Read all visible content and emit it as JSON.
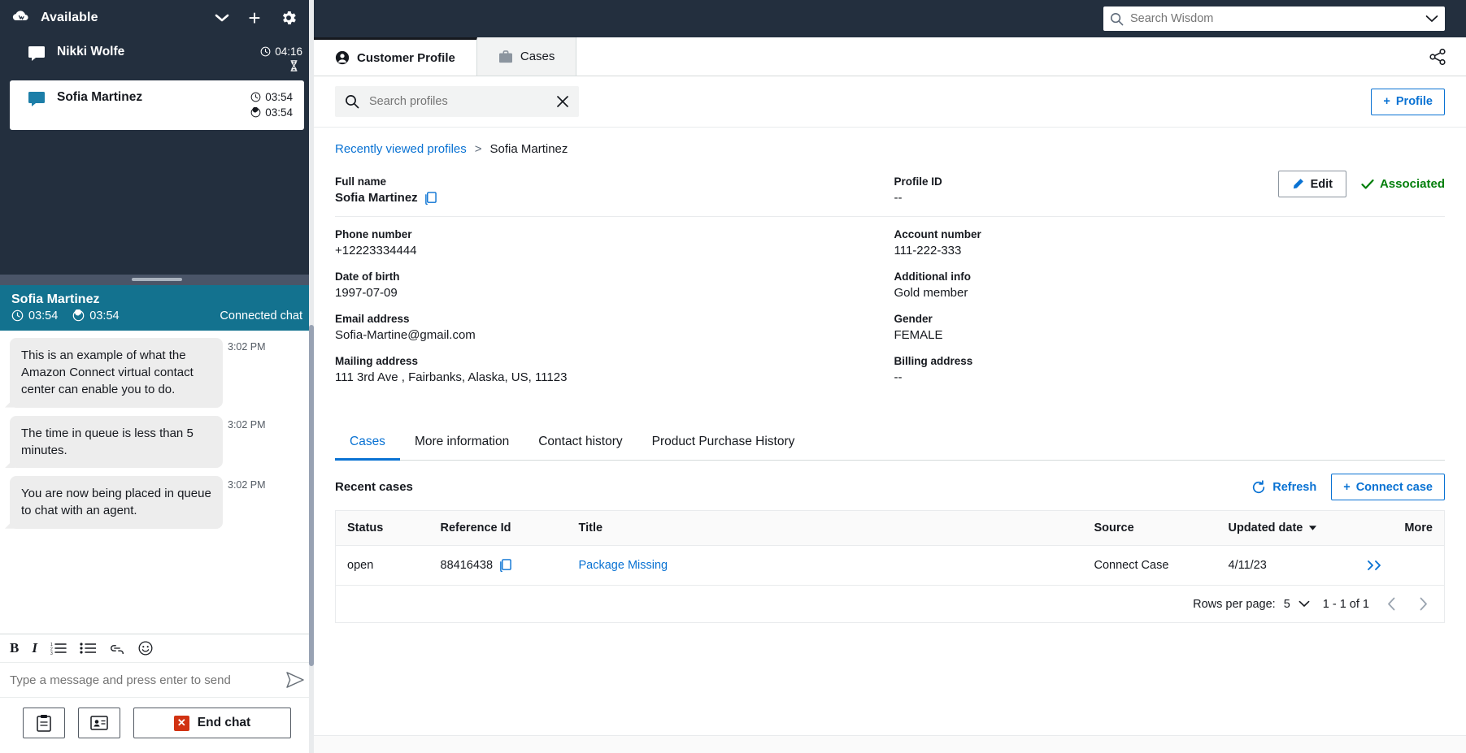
{
  "ccp": {
    "agent_status": "Available",
    "icons": {
      "logo": "amazon-connect-logo-icon",
      "chevron": "chevron-down-icon",
      "plus": "add-icon",
      "gear": "settings-gear-icon"
    },
    "contacts": [
      {
        "name": "Nikki Wolfe",
        "chat_icon": "chat-bubble-icon",
        "selected": false,
        "timers": [
          {
            "icon": "clock-icon",
            "value": "04:16"
          },
          {
            "icon": "hourglass-icon",
            "value": ""
          }
        ]
      },
      {
        "name": "Sofia Martinez",
        "chat_icon": "chat-bubble-icon",
        "selected": true,
        "timers": [
          {
            "icon": "clock-icon",
            "value": "03:54"
          },
          {
            "icon": "stopwatch-icon",
            "value": "03:54"
          }
        ]
      }
    ],
    "active_chat": {
      "customer_name": "Sofia Martinez",
      "timer_connected": "03:54",
      "timer_duration": "03:54",
      "state_label": "Connected chat",
      "messages": [
        {
          "text": "This is an example of what the Amazon Connect virtual contact center can enable you to do.",
          "time": "3:02 PM"
        },
        {
          "text": "The time in queue is less than 5 minutes.",
          "time": "3:02 PM"
        },
        {
          "text": "You are now being placed in queue to chat with an agent.",
          "time": "3:02 PM"
        }
      ]
    },
    "rich_text_toolbar": [
      {
        "name": "bold-icon",
        "label": "B"
      },
      {
        "name": "italic-icon",
        "label": "I"
      },
      {
        "name": "numbered-list-icon",
        "label": ""
      },
      {
        "name": "bulleted-list-icon",
        "label": ""
      },
      {
        "name": "link-icon",
        "label": ""
      },
      {
        "name": "emoji-icon",
        "label": ""
      }
    ],
    "composer": {
      "placeholder": "Type a message and press enter to send",
      "value": "",
      "send_icon": "send-paper-plane-icon"
    },
    "actions": {
      "quick_responses_icon": "clipboard-icon",
      "contact_attributes_icon": "contact-card-icon",
      "end_chat_label": "End chat",
      "end_chat_icon": "end-chat-x-icon"
    }
  },
  "workspace": {
    "wisdom_search": {
      "placeholder": "Search Wisdom",
      "value": "",
      "search_icon": "search-icon",
      "chevron_icon": "chevron-down-icon"
    },
    "tabs": [
      {
        "label": "Customer Profile",
        "icon": "user-circle-icon",
        "active": true
      },
      {
        "label": "Cases",
        "icon": "briefcase-icon",
        "active": false
      }
    ],
    "share_icon": "share-icon",
    "profile_search": {
      "placeholder": "Search profiles",
      "value": "",
      "search_icon": "search-icon",
      "clear_icon": "close-x-icon"
    },
    "add_profile_label": "Profile",
    "add_profile_icon": "plus-icon",
    "breadcrumb": {
      "root": "Recently viewed profiles",
      "separator": ">",
      "current": "Sofia Martinez"
    },
    "edit_button": {
      "label": "Edit",
      "icon": "pencil-edit-icon"
    },
    "association_status": {
      "label": "Associated",
      "icon": "check-icon",
      "color": "#037f0c"
    },
    "profile_fields": [
      {
        "label": "Full name",
        "value": "Sofia Martinez",
        "bold": true,
        "copy": true
      },
      {
        "label": "Profile ID",
        "value": "--",
        "bold": false,
        "copy": false
      },
      {
        "label": "Phone number",
        "value": "+12223334444",
        "bold": false,
        "copy": false
      },
      {
        "label": "Account number",
        "value": "111-222-333",
        "bold": false,
        "copy": false
      },
      {
        "label": "Date of birth",
        "value": "1997-07-09",
        "bold": false,
        "copy": false
      },
      {
        "label": "Additional info",
        "value": "Gold member",
        "bold": false,
        "copy": false
      },
      {
        "label": "Email address",
        "value": "Sofia-Martine@gmail.com",
        "bold": false,
        "copy": false
      },
      {
        "label": "Gender",
        "value": "FEMALE",
        "bold": false,
        "copy": false
      },
      {
        "label": "Mailing address",
        "value": "111 3rd Ave , Fairbanks, Alaska, US, 11123",
        "bold": false,
        "copy": false
      },
      {
        "label": "Billing address",
        "value": "--",
        "bold": false,
        "copy": false
      }
    ],
    "sub_tabs": [
      {
        "label": "Cases",
        "active": true
      },
      {
        "label": "More information",
        "active": false
      },
      {
        "label": "Contact history",
        "active": false
      },
      {
        "label": "Product Purchase History",
        "active": false
      }
    ],
    "cases_section": {
      "title": "Recent cases",
      "refresh_label": "Refresh",
      "refresh_icon": "refresh-icon",
      "connect_case_label": "Connect case",
      "connect_case_icon": "plus-icon",
      "columns": [
        "Status",
        "Reference Id",
        "Title",
        "Source",
        "Updated date",
        "More"
      ],
      "sorted_column": "Updated date",
      "sort_icon": "sort-descending-caret-icon",
      "rows": [
        {
          "status": "open",
          "reference_id": "88416438",
          "reference_copy_icon": "copy-icon",
          "title": "Package Missing",
          "source": "Connect Case",
          "updated_date": "4/11/23",
          "more_icon": "double-chevron-right-icon"
        }
      ],
      "pagination": {
        "rows_per_page_label": "Rows per page:",
        "rows_per_page_value": "5",
        "chevron_icon": "chevron-down-icon",
        "range_label": "1 - 1 of 1",
        "prev_icon": "chevron-left-icon",
        "next_icon": "chevron-right-icon"
      }
    }
  }
}
